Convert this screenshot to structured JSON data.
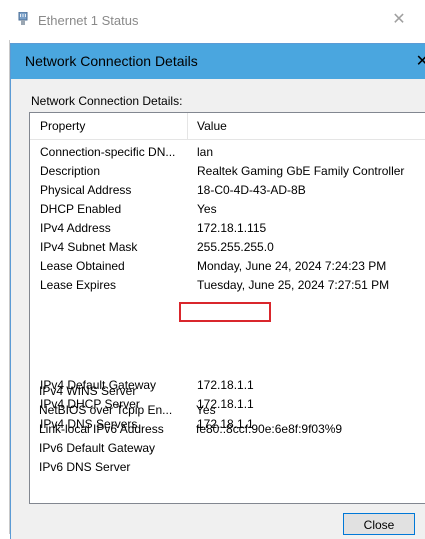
{
  "background_window": {
    "title": "Ethernet 1 Status",
    "close_glyph": "✕",
    "icon": "network-adapter-icon"
  },
  "dialog": {
    "title": "Network Connection Details",
    "close_glyph": "✕",
    "group_label": "Network Connection Details:",
    "accent_color": "#4aa6df",
    "highlight_color": "#d9262c",
    "columns": {
      "property": "Property",
      "value": "Value"
    },
    "rows": [
      {
        "property": "Connection-specific DN...",
        "value": "lan"
      },
      {
        "property": "Description",
        "value": "Realtek Gaming GbE Family Controller"
      },
      {
        "property": "Physical Address",
        "value": "18-C0-4D-43-AD-8B"
      },
      {
        "property": "DHCP Enabled",
        "value": "Yes"
      },
      {
        "property": "IPv4 Address",
        "value": "172.18.1.115"
      },
      {
        "property": "IPv4 Subnet Mask",
        "value": "255.255.255.0"
      },
      {
        "property": "Lease Obtained",
        "value": "Monday, June 24, 2024 7:24:23 PM"
      },
      {
        "property": "Lease Expires",
        "value": "Tuesday, June 25, 2024 7:27:51 PM"
      },
      {
        "property": "IPv4 Default Gateway",
        "value": "172.18.1.1"
      },
      {
        "property": "IPv4 DHCP Server",
        "value": "172.18.1.1"
      },
      {
        "property": "IPv4 DNS Servers",
        "value": "172.18.1.1"
      },
      {
        "property": "",
        "value": ""
      },
      {
        "property": "IPv4 WINS Server",
        "value": ""
      },
      {
        "property": "NetBIOS over Tcpip En...",
        "value": "Yes"
      },
      {
        "property": "Link-local IPv6 Address",
        "value": "fe80::8ccf:90e:6e8f:9f03%9"
      },
      {
        "property": "IPv6 Default Gateway",
        "value": ""
      },
      {
        "property": "IPv6 DNS Server",
        "value": ""
      }
    ],
    "close_button_label": "Close"
  }
}
